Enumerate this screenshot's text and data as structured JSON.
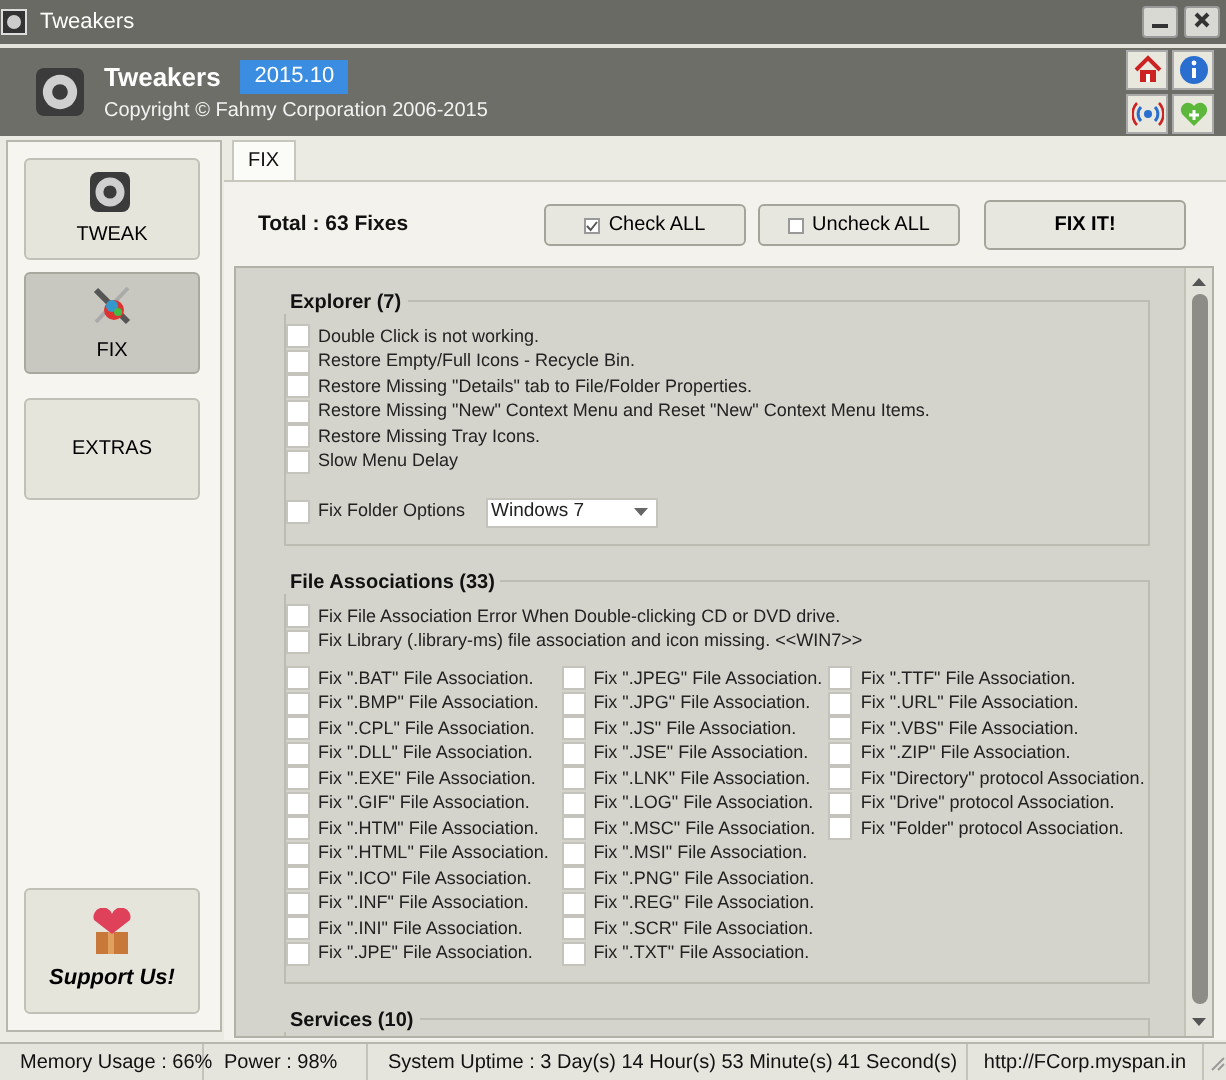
{
  "window": {
    "title": "Tweakers"
  },
  "header": {
    "app_name": "Tweakers",
    "version": "2015.10",
    "copyright": "Copyright © Fahmy Corporation 2006-2015"
  },
  "sidebar": {
    "items": [
      {
        "label": "TWEAK",
        "selected": false
      },
      {
        "label": "FIX",
        "selected": true
      },
      {
        "label": "EXTRAS",
        "selected": false
      }
    ],
    "support": "Support Us!"
  },
  "tabs": [
    {
      "label": "FIX",
      "selected": true
    }
  ],
  "toolbar": {
    "total": "Total : 63 Fixes",
    "check_all": "Check ALL",
    "uncheck_all": "Uncheck ALL",
    "fix": "FIX IT!"
  },
  "sections": [
    {
      "title": "Explorer (7)",
      "items": [
        {
          "label": "Double Click is not working.",
          "checked": false
        },
        {
          "label": "Restore Empty/Full Icons - Recycle Bin.",
          "checked": false
        },
        {
          "label": "Restore Missing \"Details\" tab to File/Folder Properties.",
          "checked": false
        },
        {
          "label": "Restore Missing \"New\" Context Menu and Reset \"New\" Context Menu Items.",
          "checked": false
        },
        {
          "label": "Restore Missing Tray Icons.",
          "checked": false
        },
        {
          "label": "Slow Menu Delay",
          "checked": false
        }
      ],
      "folder_option": {
        "label": "Fix Folder Options",
        "checked": false,
        "value": "Windows 7"
      }
    },
    {
      "title": "File Associations (33)",
      "items": [
        {
          "label": "Fix File Association Error When Double-clicking CD or DVD drive.",
          "checked": false
        },
        {
          "label": "Fix Library (.library-ms) file association and icon missing. <<WIN7>>",
          "checked": false
        }
      ],
      "columns": [
        [
          {
            "label": "Fix \".BAT\" File Association.",
            "checked": false
          },
          {
            "label": "Fix \".BMP\" File Association.",
            "checked": false
          },
          {
            "label": "Fix \".CPL\" File Association.",
            "checked": false
          },
          {
            "label": "Fix \".DLL\" File Association.",
            "checked": false
          },
          {
            "label": "Fix \".EXE\" File Association.",
            "checked": false
          },
          {
            "label": "Fix \".GIF\" File Association.",
            "checked": false
          },
          {
            "label": "Fix \".HTM\" File Association.",
            "checked": false
          },
          {
            "label": "Fix \".HTML\" File Association.",
            "checked": false
          },
          {
            "label": "Fix \".ICO\" File Association.",
            "checked": false
          },
          {
            "label": "Fix \".INF\" File Association.",
            "checked": false
          },
          {
            "label": "Fix \".INI\" File Association.",
            "checked": false
          },
          {
            "label": "Fix \".JPE\" File Association.",
            "checked": false
          }
        ],
        [
          {
            "label": "Fix \".JPEG\" File Association.",
            "checked": false
          },
          {
            "label": "Fix \".JPG\" File Association.",
            "checked": false
          },
          {
            "label": "Fix \".JS\" File Association.",
            "checked": false
          },
          {
            "label": "Fix \".JSE\" File Association.",
            "checked": false
          },
          {
            "label": "Fix \".LNK\" File Association.",
            "checked": false
          },
          {
            "label": "Fix \".LOG\" File Association.",
            "checked": false
          },
          {
            "label": "Fix \".MSC\" File Association.",
            "checked": false
          },
          {
            "label": "Fix \".MSI\" File Association.",
            "checked": false
          },
          {
            "label": "Fix \".PNG\" File Association.",
            "checked": false
          },
          {
            "label": "Fix \".REG\" File Association.",
            "checked": false
          },
          {
            "label": "Fix \".SCR\" File Association.",
            "checked": false
          },
          {
            "label": "Fix \".TXT\" File Association.",
            "checked": false
          }
        ],
        [
          {
            "label": "Fix \".TTF\" File Association.",
            "checked": false
          },
          {
            "label": "Fix \".URL\" File Association.",
            "checked": false
          },
          {
            "label": "Fix \".VBS\" File Association.",
            "checked": false
          },
          {
            "label": "Fix \".ZIP\" File Association.",
            "checked": false
          },
          {
            "label": "Fix \"Directory\" protocol Association.",
            "checked": false
          },
          {
            "label": "Fix \"Drive\" protocol Association.",
            "checked": false
          },
          {
            "label": "Fix \"Folder\" protocol Association.",
            "checked": false
          }
        ]
      ]
    },
    {
      "title": "Services (10)"
    }
  ],
  "status_bar": [
    "Memory Usage : 66%",
    "Power : 98%",
    "System Uptime : 3 Day(s) 14 Hour(s) 53 Minute(s) 41 Second(s)",
    "http://FCorp.myspan.in"
  ]
}
